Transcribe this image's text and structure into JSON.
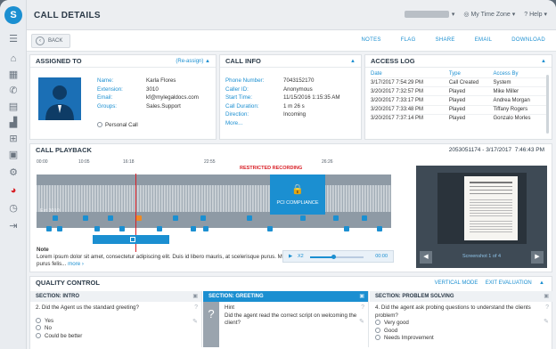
{
  "app": {
    "title": "CALL DETAILS",
    "timezone_label": "My Time Zone",
    "help_label": "Help"
  },
  "toolbar": {
    "back_label": "BACK",
    "actions": [
      "NOTES",
      "FLAG",
      "SHARE",
      "EMAIL",
      "DOWNLOAD"
    ]
  },
  "assigned": {
    "header": "ASSIGNED TO",
    "reassign_label": "(Re-assign)",
    "fields": [
      {
        "label": "Name:",
        "value": "Karla Flores"
      },
      {
        "label": "Extension:",
        "value": "3010"
      },
      {
        "label": "Email:",
        "value": "kf@mylegaldocs.com"
      },
      {
        "label": "Groups:",
        "value": "Sales.Support"
      }
    ],
    "personal_call_label": "Personal Call"
  },
  "callinfo": {
    "header": "CALL INFO",
    "fields": [
      {
        "label": "Phone Number:",
        "value": "7043152170"
      },
      {
        "label": "Caller ID:",
        "value": "Anonymous"
      },
      {
        "label": "Start Time:",
        "value": "11/15/2016 1:15:35 AM"
      },
      {
        "label": "Call Duration:",
        "value": "1 m 26 s"
      },
      {
        "label": "Direction:",
        "value": "Incoming"
      }
    ],
    "more_label": "More..."
  },
  "accesslog": {
    "header": "ACCESS LOG",
    "columns": [
      "Date",
      "Type",
      "Access By"
    ],
    "rows": [
      [
        "3/17/2017 7:54:29 PM",
        "Call Created",
        "System"
      ],
      [
        "3/20/2017 7:32:57 PM",
        "Played",
        "Mike Miller"
      ],
      [
        "3/20/2017 7:33:17 PM",
        "Played",
        "Andrea Morgan"
      ],
      [
        "3/20/2017 7:33:48 PM",
        "Played",
        "Tiffany Rogers"
      ],
      [
        "3/20/2017 7:37:14 PM",
        "Played",
        "Gonzalo Morles"
      ]
    ]
  },
  "playback": {
    "header": "CALL PLAYBACK",
    "call_id": "2053051174 - 3/17/2017",
    "call_time": "7:46:43 PM",
    "ticks": [
      "00:00",
      "10:05",
      "16:18",
      "22:55",
      "26:26"
    ],
    "restricted_label": "RESTRICTED RECORDING",
    "pci_label": "PCI COMPLIANCE",
    "track_label": "Ext 3010",
    "note_title": "Note",
    "note_text": "Lorem ipsum dolor sit amet, consectetur adipiscing elit. Duis id libero mauris, at scelerisque purus. Maecenus purus felis...",
    "more_link": "more",
    "speed_label": "X2",
    "time_readout": "00:00",
    "screenshot_label": "Screenshot 1 of 4"
  },
  "quality": {
    "header": "QUALITY CONTROL",
    "vertical_mode": "VERTICAL MODE",
    "exit_eval": "EXIT EVALUATION",
    "sections": [
      {
        "title": "SECTION: INTRO",
        "question": "2. Did the Agent us the standard greeting?",
        "options": [
          "Yes",
          "No",
          "Could be better"
        ]
      },
      {
        "title": "SECTION: GREETING",
        "hint_label": "Hint",
        "question": "Did the agent read the correct script on welcoming the client?",
        "options": []
      },
      {
        "title": "SECTION: PROBLEM SOLVING",
        "question": "4. Did the agent ask probing questions to understand the clients problem?",
        "options": [
          "Very good",
          "Good",
          "Needs Improvement"
        ]
      }
    ]
  },
  "colors": {
    "accent": "#1b8fd1",
    "restricted": "#d81f26"
  }
}
